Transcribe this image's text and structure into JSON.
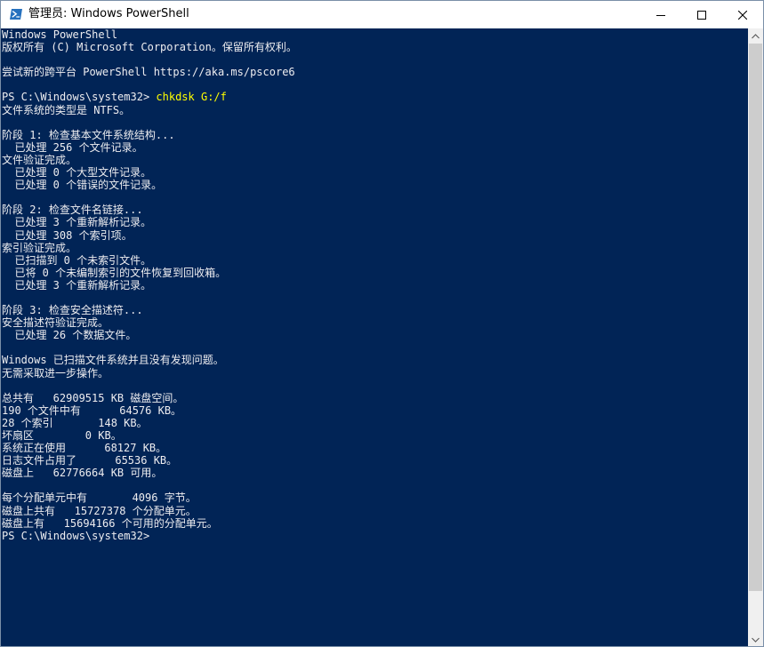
{
  "window": {
    "title": "管理员: Windows PowerShell",
    "controls": {
      "minimize": "minimize-icon",
      "maximize": "maximize-icon",
      "close": "close-icon"
    },
    "colors": {
      "console_bg": "#012456",
      "console_fg": "#eeedf0",
      "command_fg": "#ffff00"
    }
  },
  "console": {
    "lines": [
      "Windows PowerShell",
      "版权所有 (C) Microsoft Corporation。保留所有权利。",
      "",
      "尝试新的跨平台 PowerShell https://aka.ms/pscore6",
      "",
      "PS C:\\Windows\\system32> ",
      "文件系统的类型是 NTFS。",
      "",
      "阶段 1: 检查基本文件系统结构...",
      "  已处理 256 个文件记录。",
      "文件验证完成。",
      "  已处理 0 个大型文件记录。",
      "  已处理 0 个错误的文件记录。",
      "",
      "阶段 2: 检查文件名链接...",
      "  已处理 3 个重新解析记录。",
      "  已处理 308 个索引项。",
      "索引验证完成。",
      "  已扫描到 0 个未索引文件。",
      "  已将 0 个未编制索引的文件恢复到回收箱。",
      "  已处理 3 个重新解析记录。",
      "",
      "阶段 3: 检查安全描述符...",
      "安全描述符验证完成。",
      "  已处理 26 个数据文件。",
      "",
      "Windows 已扫描文件系统并且没有发现问题。",
      "无需采取进一步操作。",
      "",
      "总共有   62909515 KB 磁盘空间。",
      "190 个文件中有      64576 KB。",
      "28 个索引       148 KB。",
      "坏扇区        0 KB。",
      "系统正在使用      68127 KB。",
      "日志文件占用了      65536 KB。",
      "磁盘上   62776664 KB 可用。",
      "",
      "每个分配单元中有       4096 字节。",
      "磁盘上共有   15727378 个分配单元。",
      "磁盘上有   15694166 个可用的分配单元。",
      "PS C:\\Windows\\system32>"
    ],
    "command": "chkdsk G:/f",
    "command_line_index": 5
  }
}
